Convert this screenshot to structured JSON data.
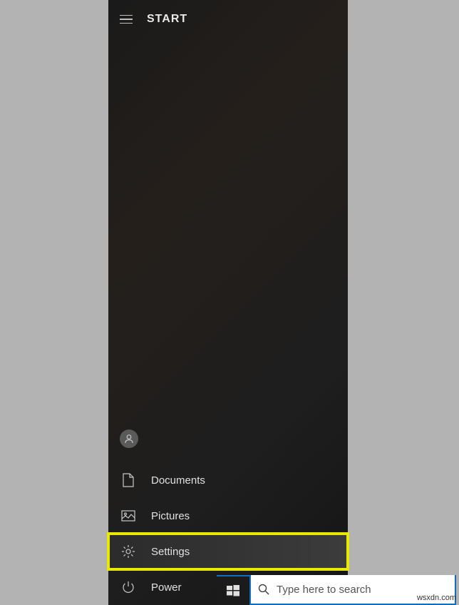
{
  "header": {
    "title": "START"
  },
  "menu": {
    "documents_label": "Documents",
    "pictures_label": "Pictures",
    "settings_label": "Settings",
    "power_label": "Power"
  },
  "search": {
    "placeholder": "Type here to search"
  },
  "watermark": "wsxdn.com"
}
